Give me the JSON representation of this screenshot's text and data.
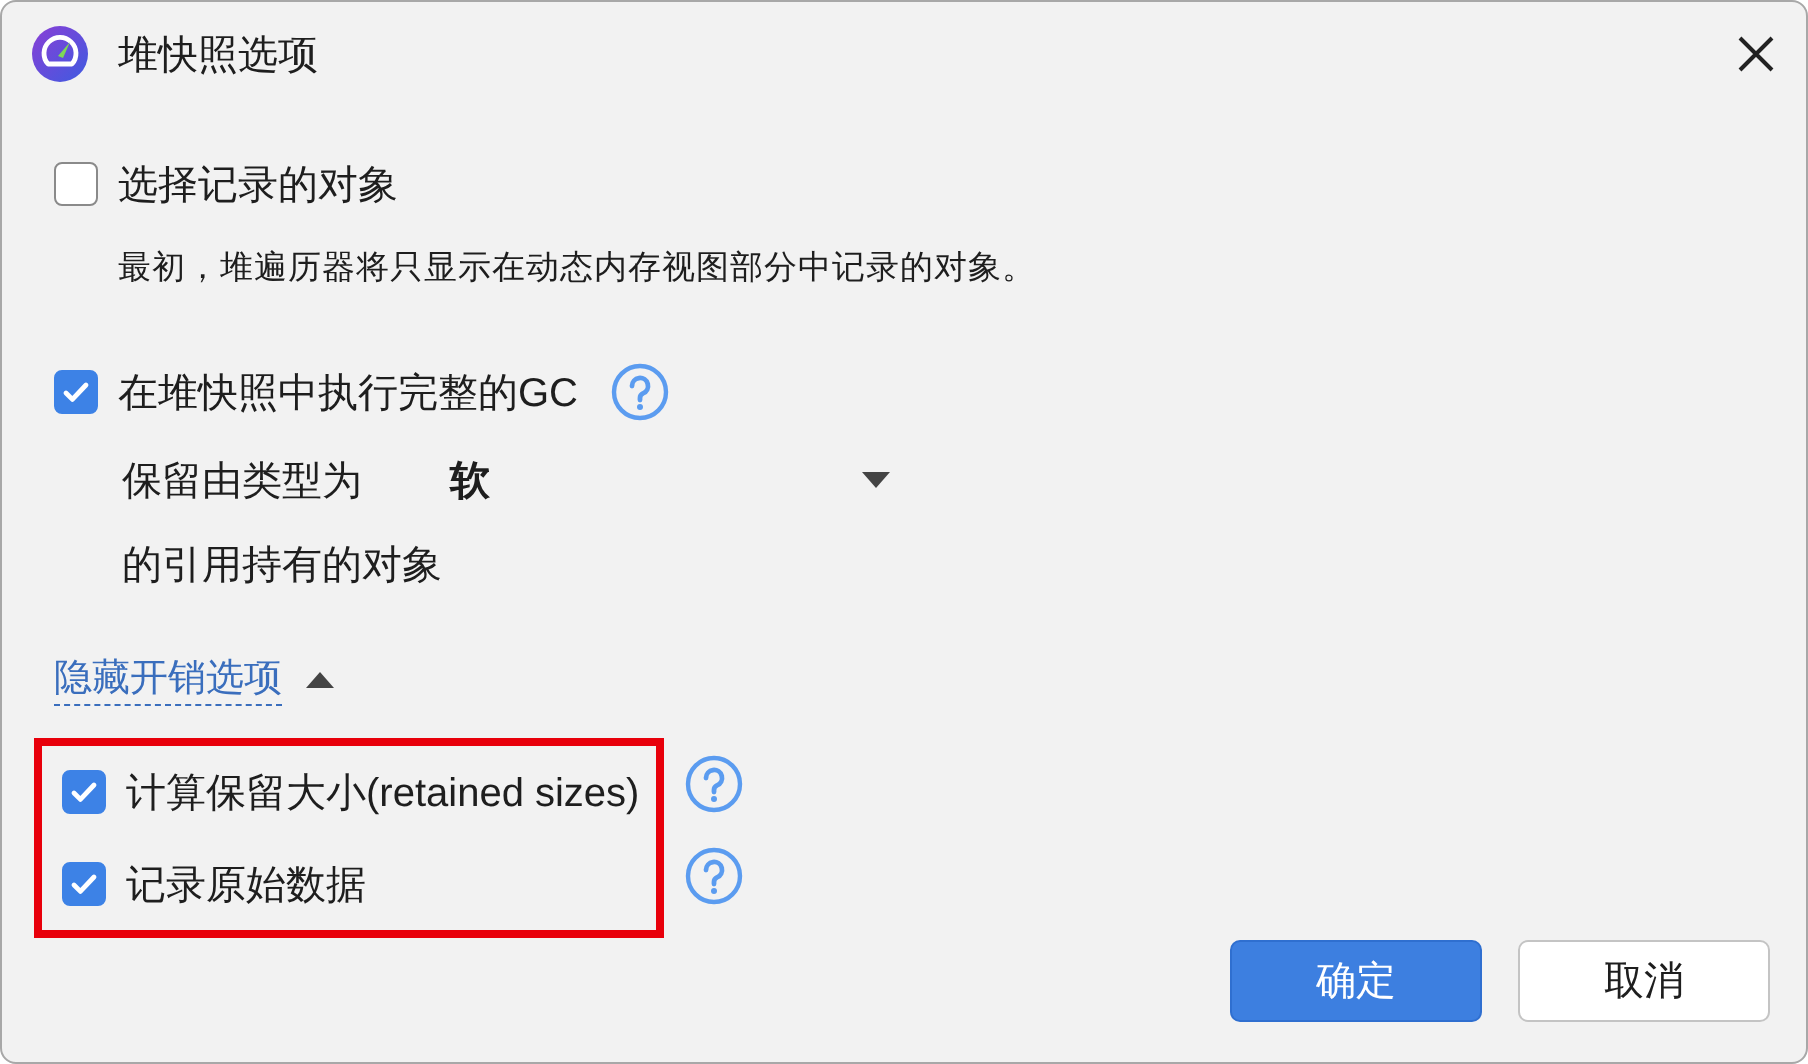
{
  "window": {
    "title": "堆快照选项"
  },
  "options": [
    {
      "label": "选择记录的对象",
      "checked": false,
      "help": false,
      "description": "最初，堆遍历器将只显示在动态内存视图部分中记录的对象。"
    },
    {
      "label": "在堆快照中执行完整的GC",
      "checked": true,
      "help": true
    }
  ],
  "retain": {
    "prefix": "保留由类型为",
    "value": "软",
    "suffix": "的引用持有的对象"
  },
  "overhead_toggle": {
    "label": "隐藏开销选项",
    "expanded": true
  },
  "overhead_options": {
    "highlighted": true,
    "items": [
      {
        "label": "计算保留大小(retained sizes)",
        "checked": true,
        "help": true
      },
      {
        "label": "记录原始数据",
        "checked": true,
        "help": true
      }
    ]
  },
  "buttons": [
    {
      "label": "确定",
      "kind": "primary"
    },
    {
      "label": "取消",
      "kind": "secondary"
    }
  ]
}
